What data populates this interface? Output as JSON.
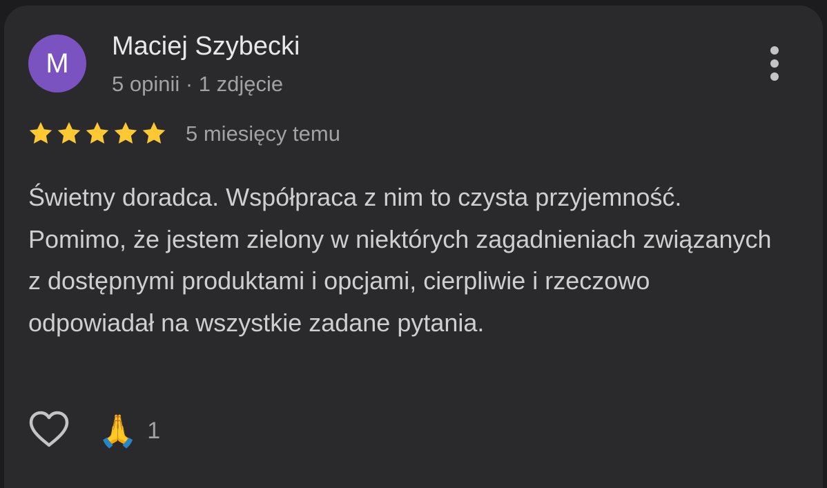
{
  "review": {
    "author": {
      "initial": "M",
      "name": "Maciej Szybecki",
      "meta": "5 opinii · 1 zdjęcie",
      "avatar_color": "#7b53c1"
    },
    "rating": 5,
    "rating_max": 5,
    "date": "5 miesięcy temu",
    "text": "Świetny doradca. Współpraca z nim to czysta przyjemność. Pomimo, że jestem zielony w niektórych zagadnieniach związanych z dostępnymi produktami i opcjami, cierpliwie i rzeczowo odpowiadał na wszystkie zadane pytania.",
    "reactions": {
      "emoji": "🙏",
      "count": "1"
    }
  },
  "icons": {
    "more": "more-vert-icon",
    "like": "heart-outline-icon",
    "star": "star-icon"
  },
  "colors": {
    "background": "#1c1c1e",
    "card": "#2a2a2c",
    "star": "#fcc934",
    "primary_text": "#e8e8ea",
    "secondary_text": "#a2a2a6",
    "body_text": "#cfcfd3"
  }
}
